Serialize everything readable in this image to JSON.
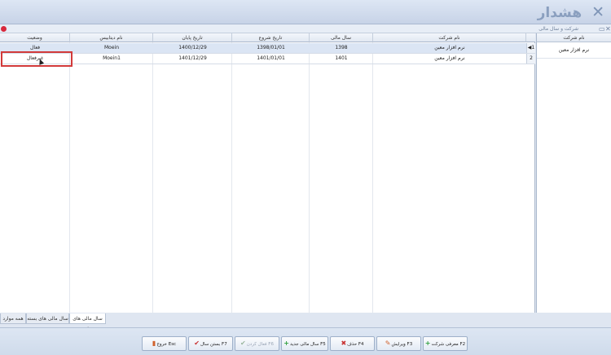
{
  "window": {
    "title": "هشدار",
    "close_glyph": "✕"
  },
  "form": {
    "caption": "شرکت و سال مالی",
    "pin_glyph": "▭",
    "close_glyph": "✕"
  },
  "company_panel": {
    "header": "نام شرکت",
    "companies": [
      "نرم افزار معین"
    ]
  },
  "grid": {
    "columns": [
      "نام شرکت",
      "سال مالی",
      "تاریخ شروع",
      "تاریخ پایان",
      "نام دیتابیس",
      "وضعیت"
    ],
    "rows": [
      {
        "index": "1",
        "indicator": "◀",
        "company": "نرم افزار معین",
        "year": "1398",
        "start": "1398/01/01",
        "end": "1400/12/29",
        "database": "Moein",
        "status": "فعال"
      },
      {
        "index": "2",
        "indicator": "",
        "company": "نرم افزار معین",
        "year": "1401",
        "start": "1401/01/01",
        "end": "1401/12/29",
        "database": "Moein1",
        "status": "غیرفعال"
      }
    ]
  },
  "tabs": [
    "سال مالی های باز",
    "سال مالی های بسته",
    "همه موارد"
  ],
  "toolbar": {
    "buttons": [
      {
        "label": "معرفی شرکت F2",
        "icon": "+"
      },
      {
        "label": "ویرایش F3",
        "icon": "✎"
      },
      {
        "label": "حذف F4",
        "icon": "✖"
      },
      {
        "label": "سال مالی جدید F5",
        "icon": "+"
      },
      {
        "label": "فعال کردن F6",
        "icon": "✔"
      },
      {
        "label": "بستن سال F7",
        "icon": "✔"
      },
      {
        "label": "خروج Esc",
        "icon": "▮"
      }
    ]
  },
  "colors": {
    "title_text": "#8a9fbf",
    "highlight": "#d23a3a",
    "selected_row": "#dbe5f4"
  }
}
